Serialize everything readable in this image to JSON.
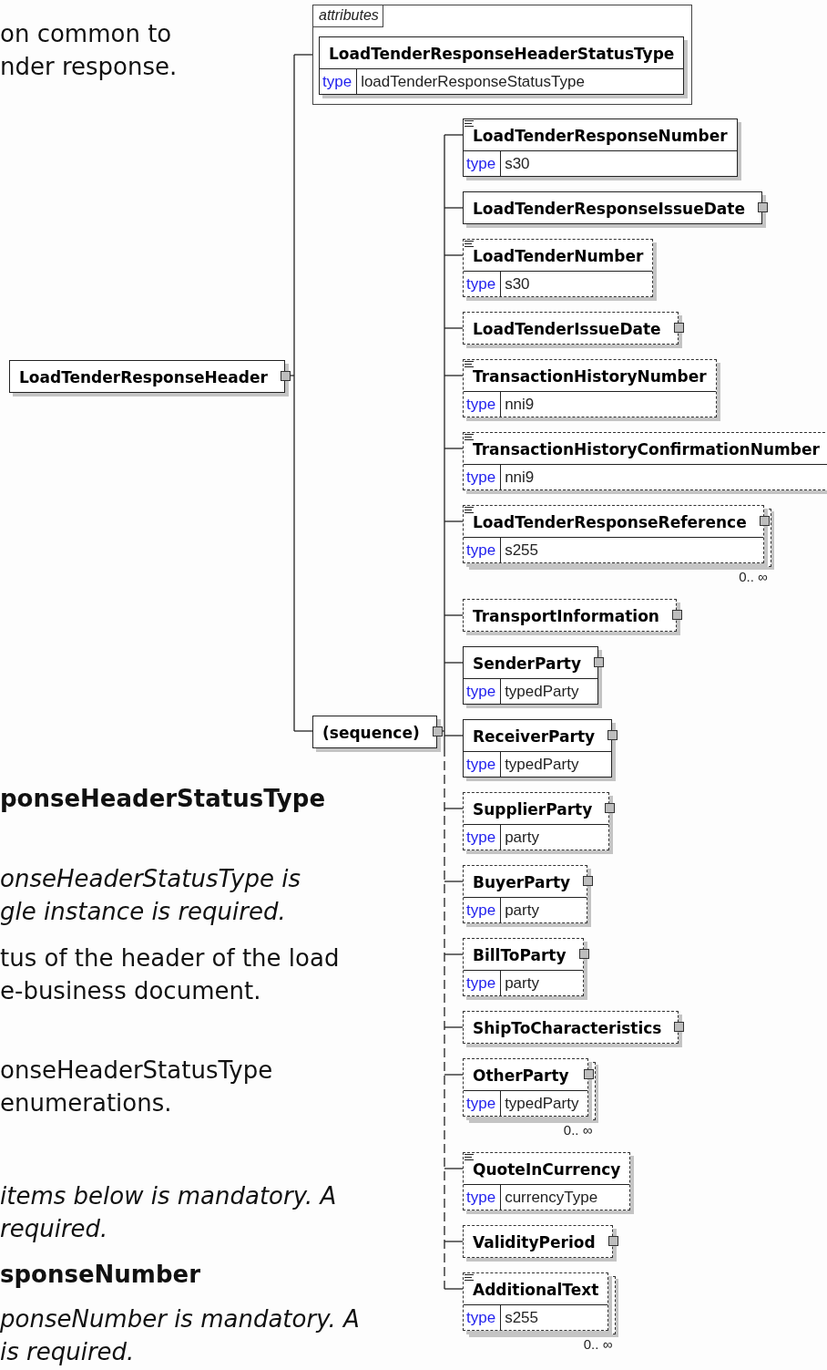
{
  "document": {
    "paragraphs": [
      {
        "kind": "body",
        "lines": [
          "on common to",
          "nder response."
        ]
      },
      {
        "kind": "heading",
        "lines": [
          "ponseHeaderStatusType"
        ]
      },
      {
        "kind": "italic",
        "lines": [
          "onseHeaderStatusType is",
          "gle instance is required."
        ]
      },
      {
        "kind": "body",
        "lines": [
          "tus of the header of the load",
          "e-business document."
        ]
      },
      {
        "kind": "body",
        "lines": [
          "onseHeaderStatusType",
          "enumerations."
        ]
      },
      {
        "kind": "italic",
        "lines": [
          "items below is mandatory. A",
          "required."
        ]
      },
      {
        "kind": "heading",
        "lines": [
          "sponseNumber"
        ]
      },
      {
        "kind": "italic",
        "lines": [
          "ponseNumber is mandatory. A",
          "is required."
        ]
      }
    ]
  },
  "diagram": {
    "root": {
      "name": "LoadTenderResponseHeader",
      "expandable": true
    },
    "attributes": {
      "label": "attributes",
      "items": [
        {
          "name": "LoadTenderResponseHeaderStatusType",
          "type_label": "type",
          "type": "loadTenderResponseStatusType"
        }
      ]
    },
    "sequence": {
      "label": "(sequence)",
      "expandable": true
    },
    "children": [
      {
        "name": "LoadTenderResponseNumber",
        "optional": false,
        "annotated": true,
        "expandable": false,
        "multiple": false,
        "type_label": "type",
        "type": "s30"
      },
      {
        "name": "LoadTenderResponseIssueDate",
        "optional": false,
        "annotated": false,
        "expandable": true,
        "multiple": false
      },
      {
        "name": "LoadTenderNumber",
        "optional": true,
        "annotated": true,
        "expandable": false,
        "multiple": false,
        "type_label": "type",
        "type": "s30"
      },
      {
        "name": "LoadTenderIssueDate",
        "optional": true,
        "annotated": false,
        "expandable": true,
        "multiple": false
      },
      {
        "name": "TransactionHistoryNumber",
        "optional": true,
        "annotated": true,
        "expandable": false,
        "multiple": false,
        "type_label": "type",
        "type": "nni9"
      },
      {
        "name": "TransactionHistoryConfirmationNumber",
        "optional": true,
        "annotated": true,
        "expandable": false,
        "multiple": false,
        "type_label": "type",
        "type": "nni9"
      },
      {
        "name": "LoadTenderResponseReference",
        "optional": true,
        "annotated": true,
        "expandable": true,
        "multiple": true,
        "type_label": "type",
        "type": "s255",
        "occurrence": "0.. ∞"
      },
      {
        "name": "TransportInformation",
        "optional": true,
        "annotated": false,
        "expandable": true,
        "multiple": false
      },
      {
        "name": "SenderParty",
        "optional": false,
        "annotated": false,
        "expandable": true,
        "multiple": false,
        "type_label": "type",
        "type": "typedParty"
      },
      {
        "name": "ReceiverParty",
        "optional": false,
        "annotated": false,
        "expandable": true,
        "multiple": false,
        "type_label": "type",
        "type": "typedParty"
      },
      {
        "name": "SupplierParty",
        "optional": true,
        "annotated": false,
        "expandable": true,
        "multiple": false,
        "type_label": "type",
        "type": "party"
      },
      {
        "name": "BuyerParty",
        "optional": true,
        "annotated": false,
        "expandable": true,
        "multiple": false,
        "type_label": "type",
        "type": "party"
      },
      {
        "name": "BillToParty",
        "optional": true,
        "annotated": false,
        "expandable": true,
        "multiple": false,
        "type_label": "type",
        "type": "party"
      },
      {
        "name": "ShipToCharacteristics",
        "optional": true,
        "annotated": false,
        "expandable": true,
        "multiple": false
      },
      {
        "name": "OtherParty",
        "optional": true,
        "annotated": false,
        "expandable": true,
        "multiple": true,
        "type_label": "type",
        "type": "typedParty",
        "occurrence": "0.. ∞"
      },
      {
        "name": "QuoteInCurrency",
        "optional": true,
        "annotated": true,
        "expandable": false,
        "multiple": false,
        "type_label": "type",
        "type": "currencyType"
      },
      {
        "name": "ValidityPeriod",
        "optional": true,
        "annotated": false,
        "expandable": true,
        "multiple": false
      },
      {
        "name": "AdditionalText",
        "optional": true,
        "annotated": true,
        "expandable": false,
        "multiple": true,
        "type_label": "type",
        "type": "s255",
        "occurrence": "0.. ∞"
      }
    ]
  }
}
